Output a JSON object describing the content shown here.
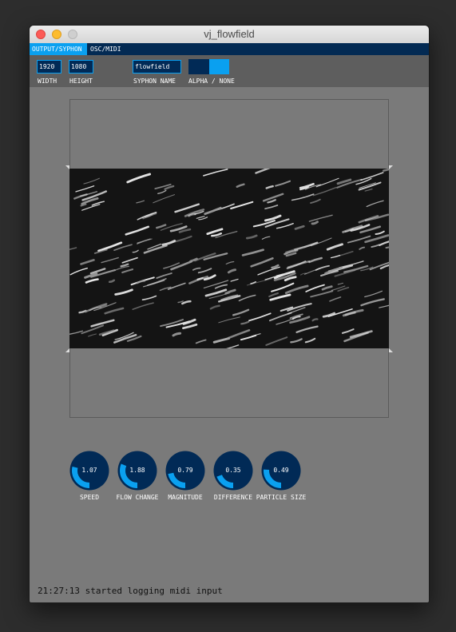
{
  "window": {
    "title": "vj_flowfield"
  },
  "tabs": [
    {
      "label": "OUTPUT/SYPHON",
      "active": true
    },
    {
      "label": "OSC/MIDI",
      "active": false
    }
  ],
  "output": {
    "width": {
      "value": "1920",
      "label": "WIDTH"
    },
    "height": {
      "value": "1080",
      "label": "HEIGHT"
    },
    "syphon_name": {
      "value": "flowfield",
      "label": "SYPHON NAME"
    },
    "alpha_toggle": {
      "label": "ALPHA / NONE",
      "state": "none"
    }
  },
  "knobs": [
    {
      "value": "1.07",
      "label": "SPEED",
      "fraction": 0.18
    },
    {
      "value": "1.88",
      "label": "FLOW CHANGE",
      "fraction": 0.22
    },
    {
      "value": "0.79",
      "label": "MAGNITUDE",
      "fraction": 0.08
    },
    {
      "value": "0.35",
      "label": "DIFFERENCE",
      "fraction": 0.04
    },
    {
      "value": "0.49",
      "label": "PARTICLE SIZE",
      "fraction": 0.14
    }
  ],
  "status": {
    "message": "21:27:13 started logging midi input"
  },
  "colors": {
    "accent": "#0aa0f0",
    "control_bg": "#012a56",
    "tab_bar": "#032a53",
    "panel": "#7a7a7a"
  }
}
